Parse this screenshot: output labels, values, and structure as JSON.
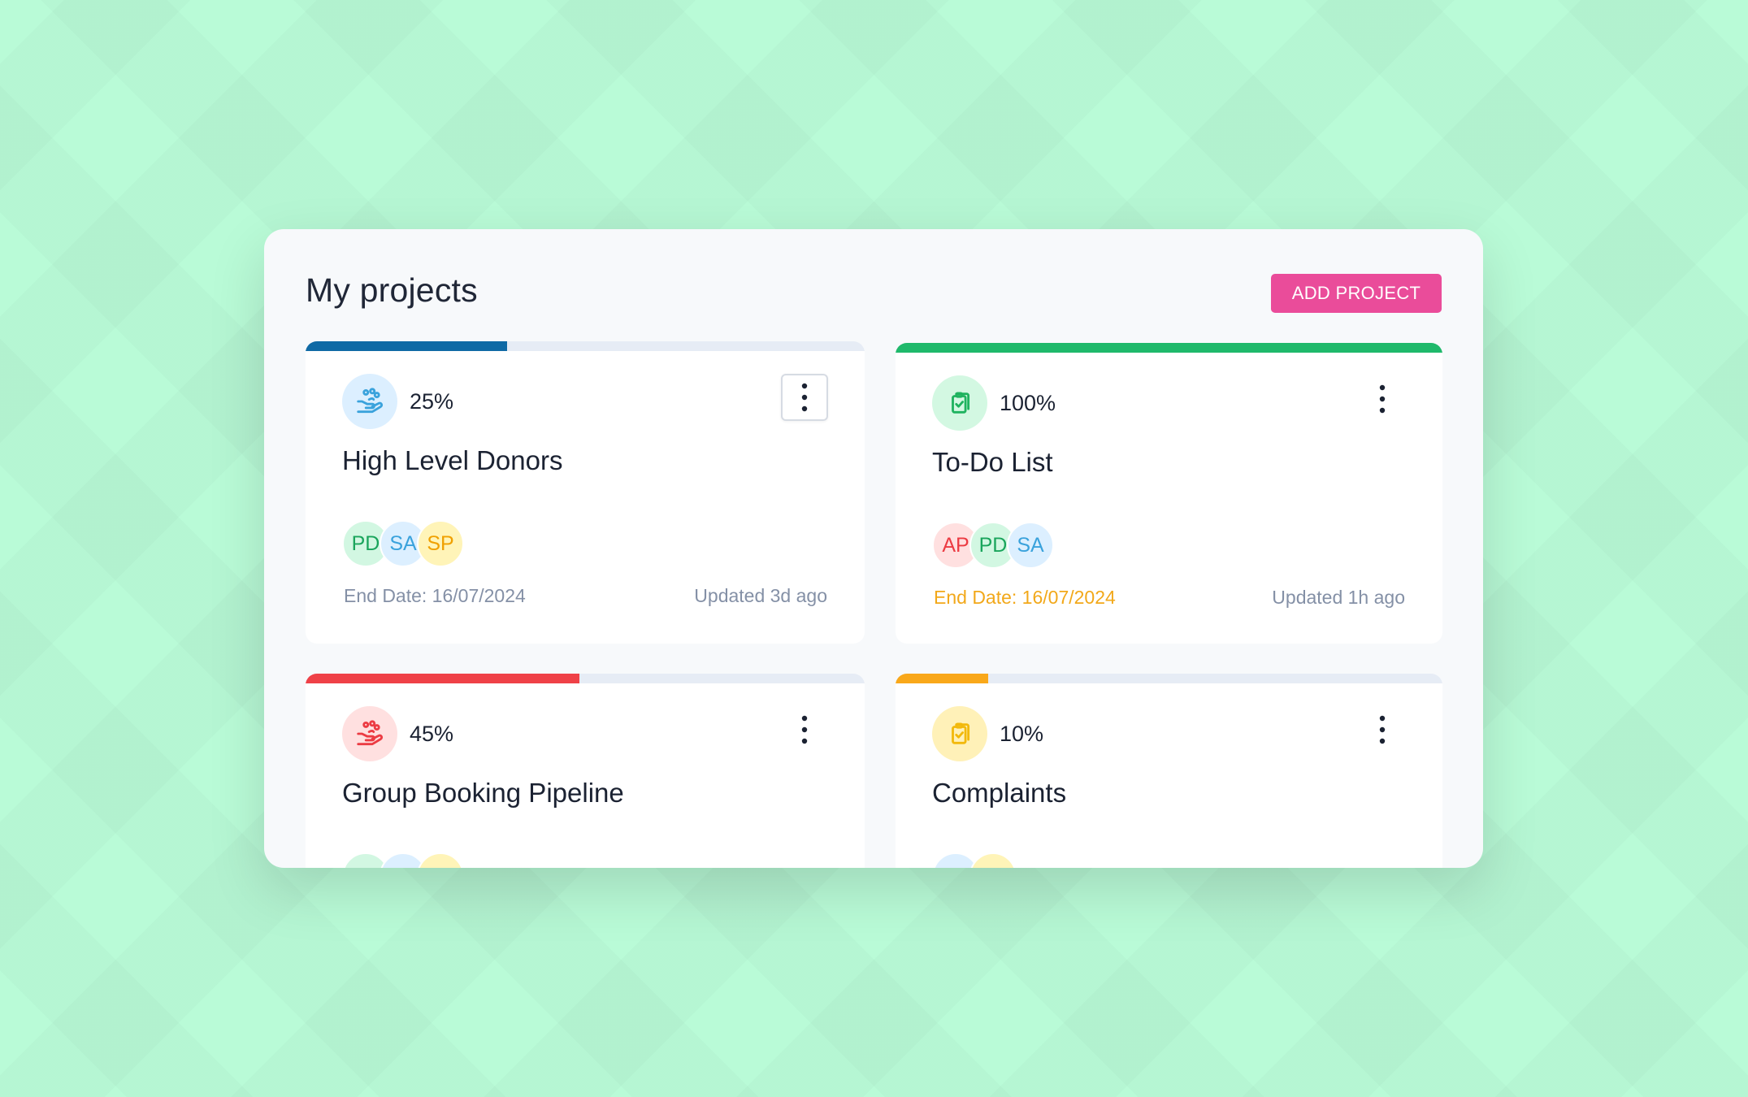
{
  "header": {
    "title": "My projects",
    "add_button_label": "ADD PROJECT",
    "add_button_color": "#ea4c9a"
  },
  "projects": [
    {
      "title": "High Level Donors",
      "percent_label": "25%",
      "progress": 0.36,
      "accent": "#0f6aa5",
      "icon": "hand-donation-icon",
      "icon_color": "#3aa2dc",
      "icon_bg": "#dcefff",
      "avatars": [
        {
          "initials": "PD",
          "color": "#1aa55c",
          "bg": "#d2f7e2"
        },
        {
          "initials": "SA",
          "color": "#3aa2dc",
          "bg": "#dcefff"
        },
        {
          "initials": "SP",
          "color": "#f0a000",
          "bg": "#fff4b8"
        }
      ],
      "end_date": "End Date: 16/07/2024",
      "end_date_color": "#8490a6",
      "updated": "Updated 3d ago",
      "menu_outlined": true
    },
    {
      "title": "To-Do List",
      "percent_label": "100%",
      "progress": 1.0,
      "accent": "#1fb96b",
      "icon": "clipboard-icon",
      "icon_color": "#1fb35f",
      "icon_bg": "#d3f8e2",
      "avatars": [
        {
          "initials": "AP",
          "color": "#ec3b43",
          "bg": "#ffe0e0"
        },
        {
          "initials": "PD",
          "color": "#1aa55c",
          "bg": "#d2f7e2"
        },
        {
          "initials": "SA",
          "color": "#3aa2dc",
          "bg": "#dcefff"
        }
      ],
      "end_date": "End Date: 16/07/2024",
      "end_date_color": "#f2a81a",
      "updated": "Updated 1h ago",
      "menu_outlined": false
    },
    {
      "title": "Group Booking Pipeline",
      "percent_label": "45%",
      "progress": 0.49,
      "accent": "#ef4147",
      "icon": "hand-donation-icon",
      "icon_color": "#ec3b43",
      "icon_bg": "#ffe0e0",
      "avatars": [
        {
          "initials": "",
          "color": "#1aa55c",
          "bg": "#d2f7e2"
        },
        {
          "initials": "",
          "color": "#3aa2dc",
          "bg": "#dcefff"
        },
        {
          "initials": "",
          "color": "#f0a000",
          "bg": "#fff4b8"
        }
      ],
      "end_date": "",
      "end_date_color": "#8490a6",
      "updated": "",
      "menu_outlined": false
    },
    {
      "title": "Complaints",
      "percent_label": "10%",
      "progress": 0.17,
      "accent": "#f9a81a",
      "icon": "clipboard-icon",
      "icon_color": "#f2b90c",
      "icon_bg": "#fff1b8",
      "avatars": [
        {
          "initials": "",
          "color": "#3aa2dc",
          "bg": "#dcefff"
        },
        {
          "initials": "",
          "color": "#f0a000",
          "bg": "#fff4b8"
        }
      ],
      "end_date": "",
      "end_date_color": "#8490a6",
      "updated": "",
      "menu_outlined": false
    }
  ]
}
